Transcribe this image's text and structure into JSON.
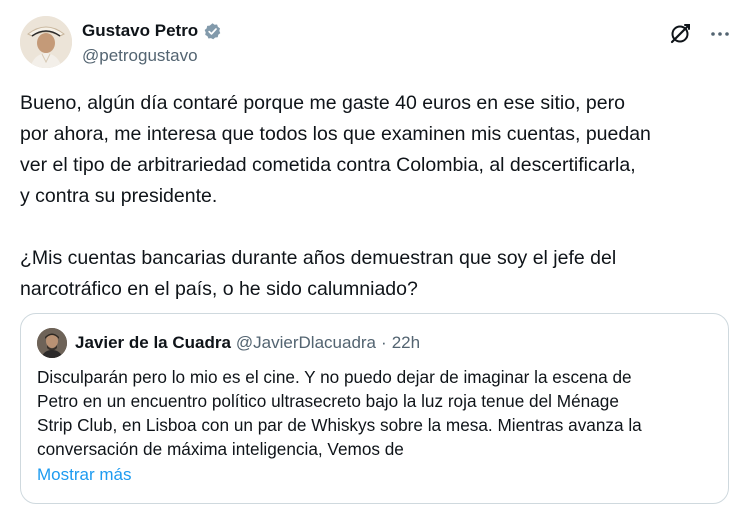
{
  "author": {
    "display_name": "Gustavo Petro",
    "handle": "@petrogustavo",
    "verified": true,
    "avatar_icon": "avatar-photo"
  },
  "actions": {
    "grok_icon": "grok-icon",
    "more_icon": "more-icon"
  },
  "tweet": {
    "paragraph1": "Bueno, algún día contaré porque me gaste 40 euros en ese sitio, pero\npor ahora, me interesa que todos los que examinen mis cuentas, puedan\nver el tipo de arbitrariedad cometida contra Colombia, al descertificarla,\ny contra su presidente.",
    "paragraph2": "¿Mis cuentas bancarias durante años demuestran que soy el jefe del\nnarcotráfico en el país, o he sido calumniado?"
  },
  "quote": {
    "display_name": "Javier de la Cuadra",
    "handle": "@JavierDlacuadra",
    "separator": "·",
    "time": "22h",
    "text_lines": [
      "Disculparán pero lo mio es el cine. Y no puedo dejar de imaginar la escena de",
      "Petro en un encuentro político ultrasecreto bajo la luz roja tenue del Ménage",
      "Strip Club, en Lisboa con un par de Whiskys sobre la mesa. Mientras avanza la",
      "conversación de máxima inteligencia, Vemos de"
    ],
    "show_more": "Mostrar más"
  },
  "colors": {
    "text": "#0f1419",
    "secondary": "#536471",
    "link": "#1d9bf0",
    "border": "#cfd9de",
    "verified": "#829aab"
  }
}
